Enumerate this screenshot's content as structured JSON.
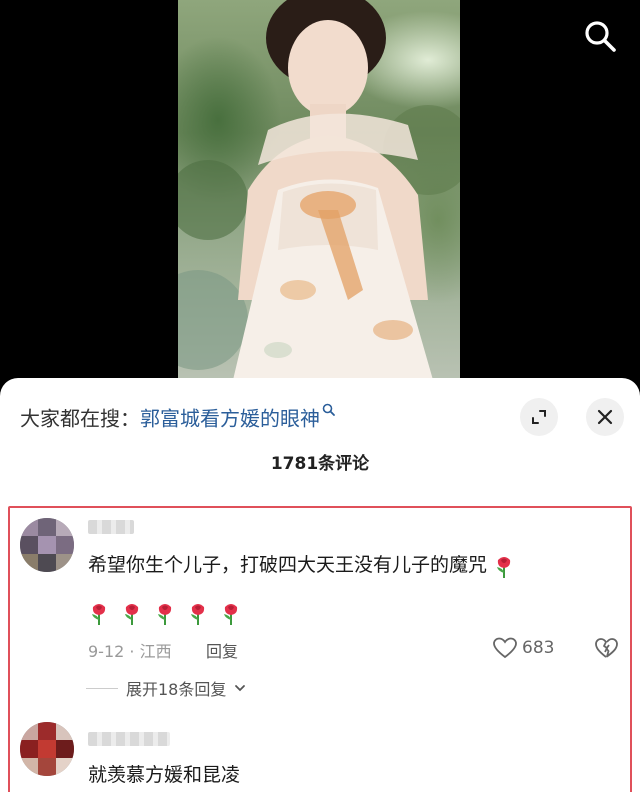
{
  "search": {
    "icon": "search-icon"
  },
  "sheet": {
    "suggest_label": "大家都在搜：",
    "suggest_term": "郭富城看方媛的眼神",
    "comment_count": "1781条评论"
  },
  "comments": [
    {
      "text": "希望你生个儿子，打破四大天王没有儿子的魔咒",
      "emoji": "rose",
      "date": "9-12",
      "location": "江西",
      "reply_label": "回复",
      "likes": "683",
      "expand_label": "展开18条回复"
    },
    {
      "text": "就羡慕方媛和昆凌"
    }
  ],
  "colors": {
    "highlight": "#e0505a",
    "link": "#2b5e9a"
  }
}
